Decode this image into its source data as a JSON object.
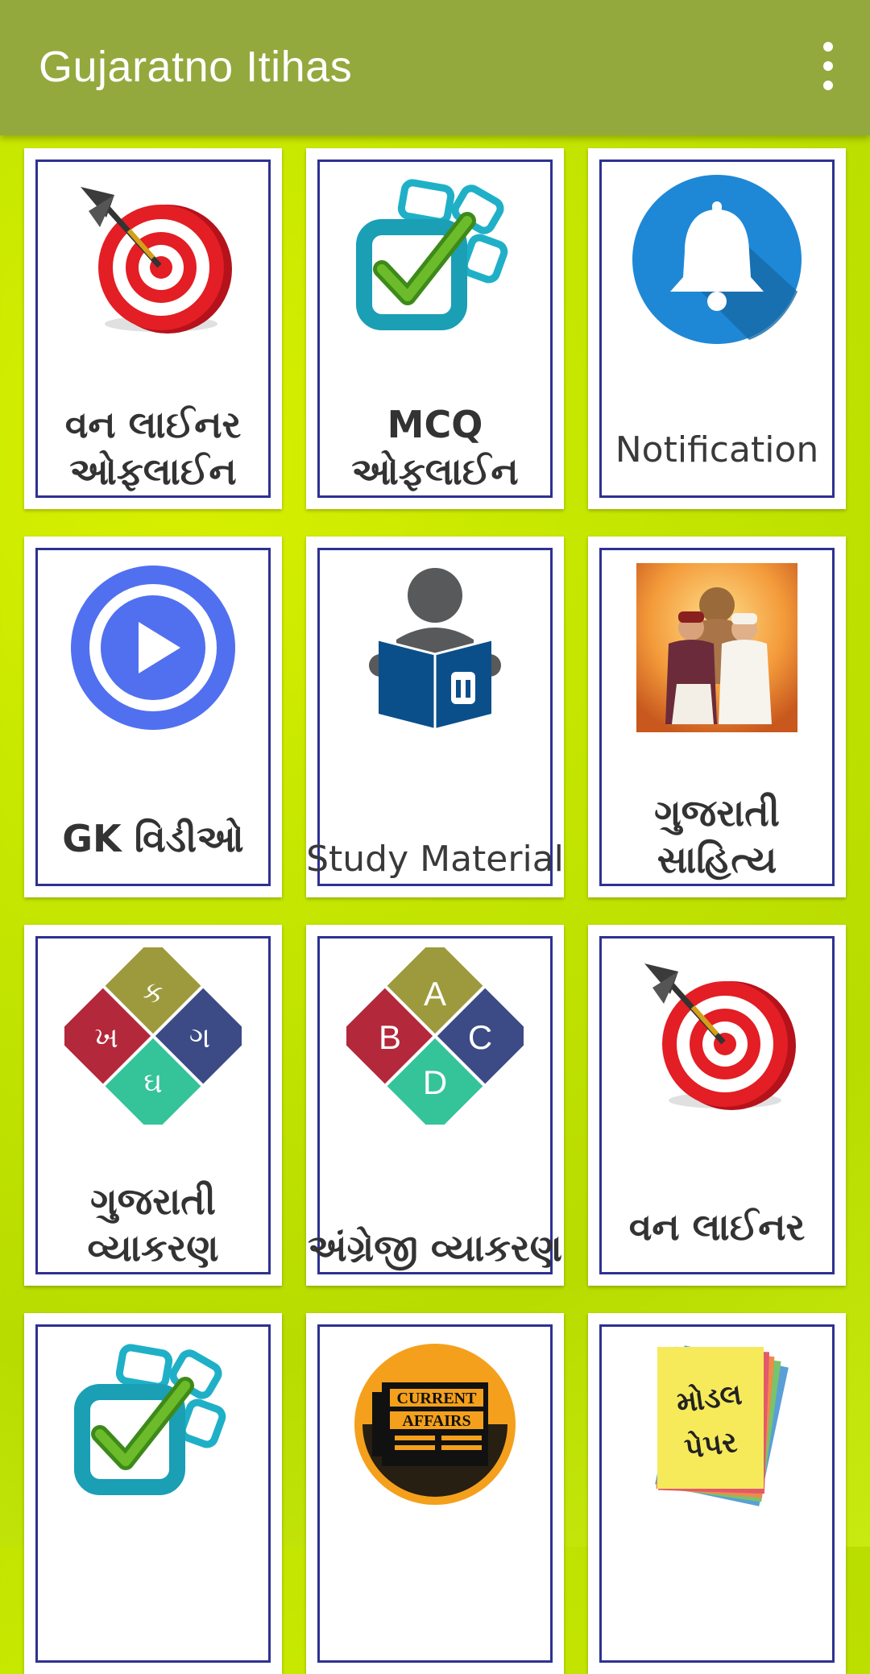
{
  "app": {
    "title": "Gujaratno Itihas",
    "menu_icon": "more-vert-icon"
  },
  "colors": {
    "appbar": "#93a93e",
    "background": "#c4e600",
    "tile_border": "#2e3192"
  },
  "tiles": [
    {
      "label": "વન લાઈનર ઓફલાઈન",
      "icon": "dartboard-icon"
    },
    {
      "label": "MCQ ઓફલાઈન",
      "icon": "checkbox-icon"
    },
    {
      "label": "Notification",
      "icon": "bell-icon"
    },
    {
      "label": "GK વિડીઓ",
      "icon": "play-icon"
    },
    {
      "label": "Study Material",
      "icon": "reading-person-icon"
    },
    {
      "label": "ગુજરાતી સાહિત્ય",
      "icon": "literature-image"
    },
    {
      "label": "ગુજરાતી વ્યાકરણ",
      "icon": "gujarati-letters-icon",
      "letters": {
        "top": "ક",
        "left": "ખ",
        "right": "ગ",
        "bottom": "ઘ"
      }
    },
    {
      "label": "અંગ્રેજી વ્યાકરણ",
      "icon": "abcd-icon",
      "letters": {
        "top": "A",
        "left": "B",
        "right": "C",
        "bottom": "D"
      }
    },
    {
      "label": "વન લાઈનર",
      "icon": "dartboard-icon"
    },
    {
      "label": "",
      "icon": "checkbox-icon"
    },
    {
      "label": "",
      "icon": "current-affairs-icon",
      "badge_line1": "CURRENT",
      "badge_line2": "AFFAIRS"
    },
    {
      "label": "",
      "icon": "model-paper-icon",
      "badge_line1": "મોડલ",
      "badge_line2": "પેપર"
    }
  ]
}
